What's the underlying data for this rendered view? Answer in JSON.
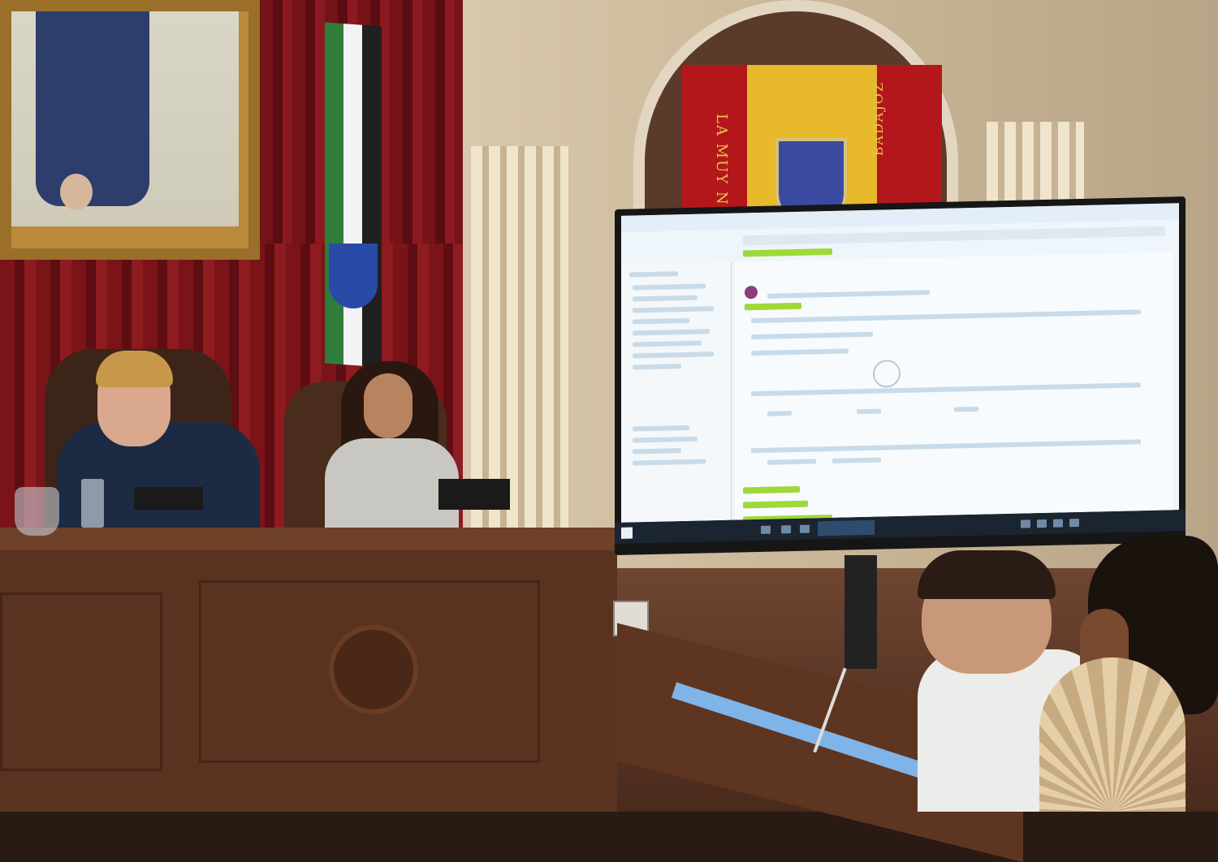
{
  "scene": {
    "description_items": [
      "painting",
      "curtains",
      "flags",
      "banner",
      "desk",
      "monitor"
    ]
  },
  "banner": {
    "left_text": "LA MUY N",
    "right_text": "BADAJOZ"
  }
}
